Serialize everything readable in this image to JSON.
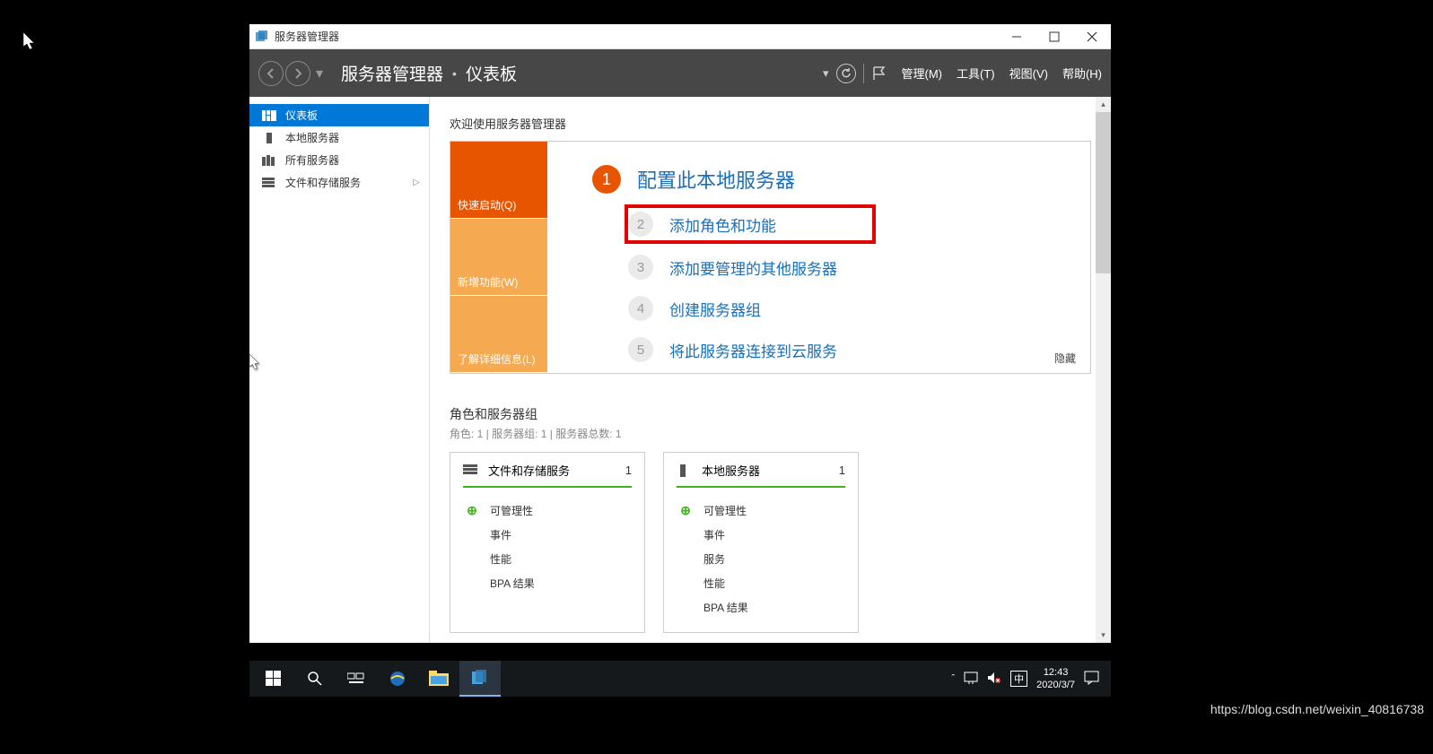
{
  "window": {
    "title": "服务器管理器",
    "breadcrumb": {
      "root": "服务器管理器",
      "current": "仪表板"
    },
    "menus": {
      "manage": "管理(M)",
      "tools": "工具(T)",
      "view": "视图(V)",
      "help": "帮助(H)"
    }
  },
  "sidebar": {
    "items": [
      {
        "label": "仪表板",
        "icon": "dashboard"
      },
      {
        "label": "本地服务器",
        "icon": "server"
      },
      {
        "label": "所有服务器",
        "icon": "servers"
      },
      {
        "label": "文件和存储服务",
        "icon": "storage",
        "expandable": true
      }
    ]
  },
  "welcome": {
    "title": "欢迎使用服务器管理器",
    "tabs": {
      "quick": "快速启动(Q)",
      "whatsnew": "新增功能(W)",
      "learn": "了解详细信息(L)"
    },
    "steps": [
      {
        "num": "1",
        "text": "配置此本地服务器"
      },
      {
        "num": "2",
        "text": "添加角色和功能"
      },
      {
        "num": "3",
        "text": "添加要管理的其他服务器"
      },
      {
        "num": "4",
        "text": "创建服务器组"
      },
      {
        "num": "5",
        "text": "将此服务器连接到云服务"
      }
    ],
    "hide": "隐藏"
  },
  "roles": {
    "title": "角色和服务器组",
    "subtitle": "角色: 1 | 服务器组: 1 | 服务器总数: 1",
    "tiles": [
      {
        "title": "文件和存储服务",
        "count": "1",
        "rows": [
          "可管理性",
          "事件",
          "性能",
          "BPA 结果"
        ]
      },
      {
        "title": "本地服务器",
        "count": "1",
        "rows": [
          "可管理性",
          "事件",
          "服务",
          "性能",
          "BPA 结果"
        ]
      }
    ]
  },
  "taskbar": {
    "time": "12:43",
    "date": "2020/3/7",
    "ime": "中"
  },
  "watermark": "https://blog.csdn.net/weixin_40816738"
}
